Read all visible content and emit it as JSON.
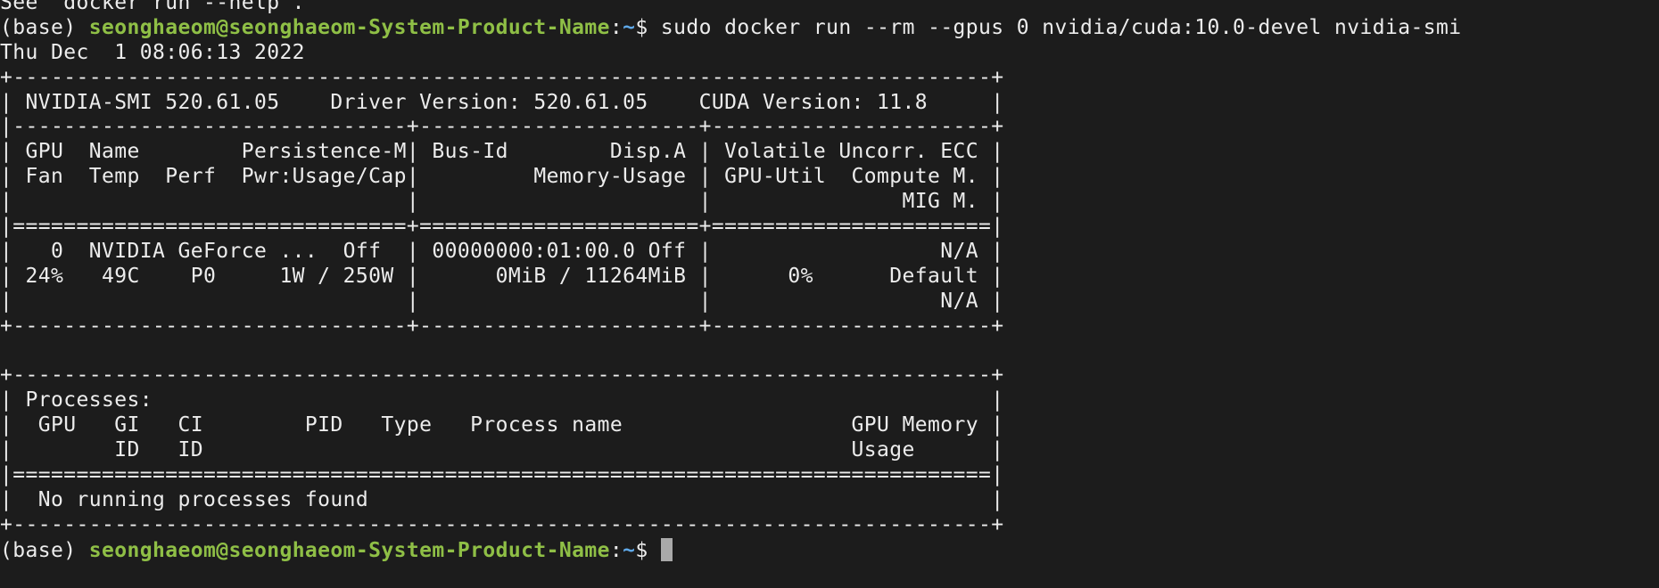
{
  "terminal": {
    "top_line": "See 'docker run --help'.",
    "prompt": {
      "env": "(base) ",
      "user_host": "seonghaeom@seonghaeom-System-Product-Name",
      "sep": ":",
      "path": "~",
      "symbol": "$ "
    },
    "command": "sudo docker run --rm --gpus 0 nvidia/cuda:10.0-devel nvidia-smi",
    "output_lines": [
      "Thu Dec  1 08:06:13 2022",
      "+-----------------------------------------------------------------------------+",
      "| NVIDIA-SMI 520.61.05    Driver Version: 520.61.05    CUDA Version: 11.8     |",
      "|-------------------------------+----------------------+----------------------+",
      "| GPU  Name        Persistence-M| Bus-Id        Disp.A | Volatile Uncorr. ECC |",
      "| Fan  Temp  Perf  Pwr:Usage/Cap|         Memory-Usage | GPU-Util  Compute M. |",
      "|                               |                      |               MIG M. |",
      "|===============================+======================+======================|",
      "|   0  NVIDIA GeForce ...  Off  | 00000000:01:00.0 Off |                  N/A |",
      "| 24%   49C    P0     1W / 250W |      0MiB / 11264MiB |      0%      Default |",
      "|                               |                      |                  N/A |",
      "+-------------------------------+----------------------+----------------------+",
      "",
      "+-----------------------------------------------------------------------------+",
      "| Processes:                                                                  |",
      "|  GPU   GI   CI        PID   Type   Process name                  GPU Memory |",
      "|        ID   ID                                                   Usage      |",
      "|=============================================================================|",
      "|  No running processes found                                                 |",
      "+-----------------------------------------------------------------------------+"
    ]
  }
}
